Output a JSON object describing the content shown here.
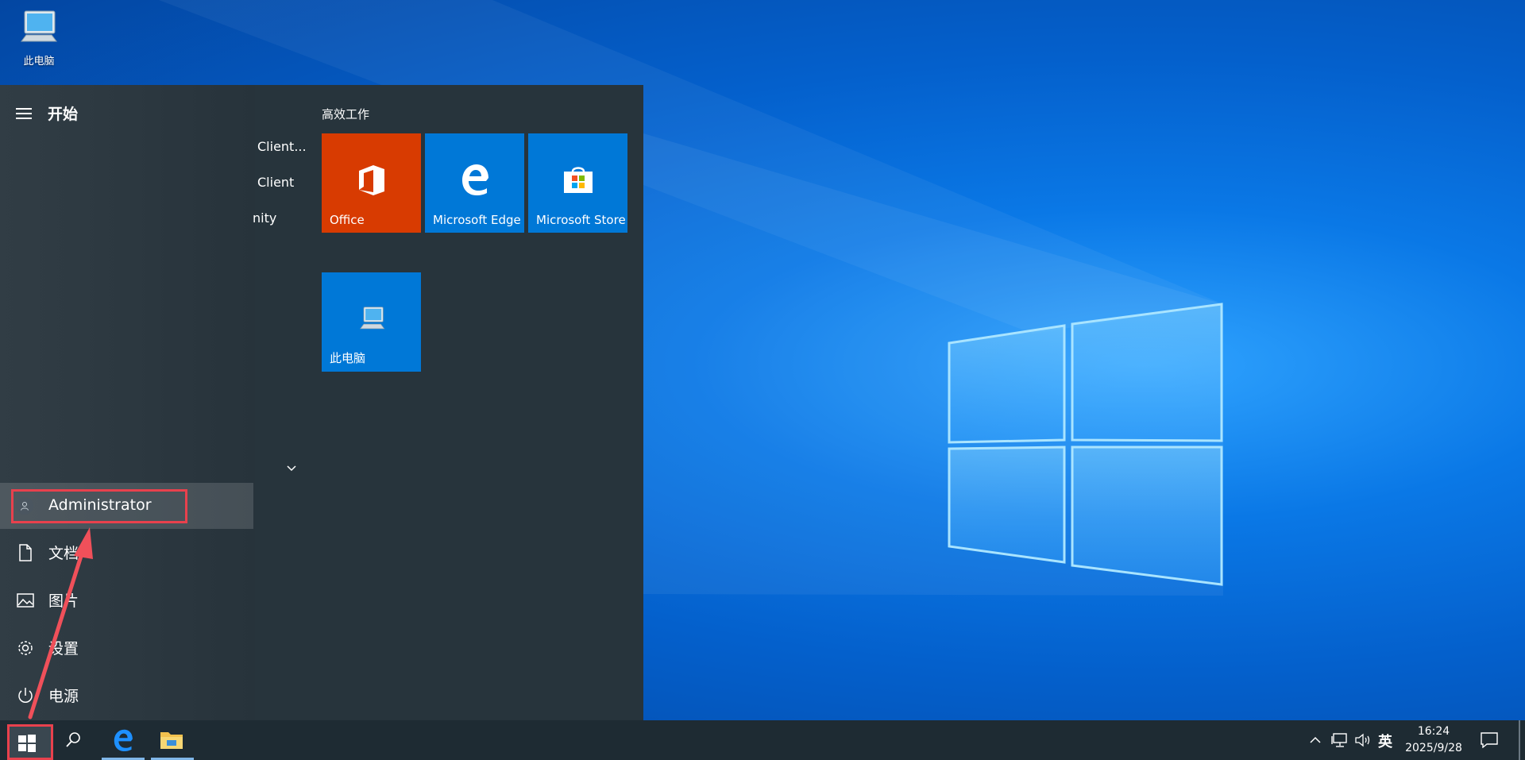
{
  "desktop": {
    "icons": [
      {
        "label": "此电脑",
        "icon": "computer-icon"
      }
    ]
  },
  "start_menu": {
    "title": "开始",
    "user": {
      "name": "Administrator"
    },
    "left_items": [
      {
        "label": "文档",
        "icon": "document-icon"
      },
      {
        "label": "图片",
        "icon": "picture-icon"
      },
      {
        "label": "设置",
        "icon": "gear-icon"
      },
      {
        "label": "电源",
        "icon": "power-icon"
      }
    ],
    "app_list": [
      "Client...",
      "Client",
      "nity"
    ],
    "tile_group": "高效工作",
    "tiles": [
      {
        "label": "Office",
        "color": "#d83b01",
        "icon": "office-icon"
      },
      {
        "label": "Microsoft Edge",
        "color": "#0078d7",
        "icon": "edge-icon"
      },
      {
        "label": "Microsoft Store",
        "color": "#0078d7",
        "icon": "store-icon"
      },
      {
        "label": "此电脑",
        "color": "#0078d7",
        "icon": "computer-icon"
      }
    ]
  },
  "taskbar": {
    "tray": {
      "ime": "英"
    },
    "clock": {
      "time": "16:24",
      "date": "2025/9/28"
    }
  },
  "colors": {
    "highlight_box": "#e8414d",
    "taskbar": "#1e2b33",
    "start_bg": "#27343c"
  }
}
